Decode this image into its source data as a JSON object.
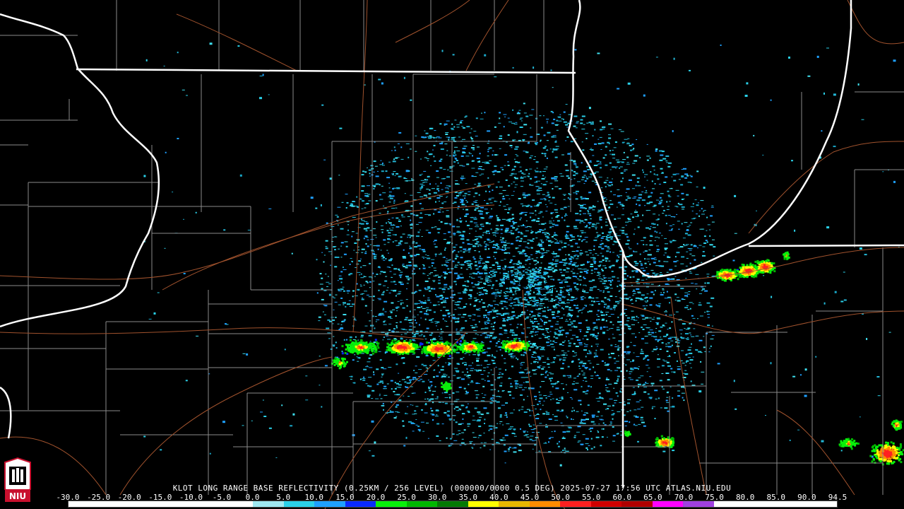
{
  "caption": "KLOT LONG RANGE BASE REFLECTIVITY (0.25KM / 256 LEVEL) (000000/0000 0.5 DEG) 2025-07-27 17:56 UTC  ATLAS.NIU.EDU",
  "logo_text": "NIU",
  "scale": {
    "labels": [
      "-30.0",
      "-25.0",
      "-20.0",
      "-15.0",
      "-10.0",
      "-5.0",
      "0.0",
      "5.0",
      "10.0",
      "15.0",
      "20.0",
      "25.0",
      "30.0",
      "35.0",
      "40.0",
      "45.0",
      "50.0",
      "55.0",
      "60.0",
      "65.0",
      "70.0",
      "75.0",
      "80.0",
      "85.0",
      "90.0",
      "94.5"
    ],
    "colors": [
      "#ffffff",
      "#ffffff",
      "#ffffff",
      "#ffffff",
      "#ffffff",
      "#ffffff",
      "#9ee7f0",
      "#2ad0e8",
      "#1ea0ff",
      "#0a2aff",
      "#08f00a",
      "#00b800",
      "#047a04",
      "#ffff00",
      "#e8b800",
      "#ff8c00",
      "#ff2020",
      "#d00000",
      "#b00000",
      "#ff00ff",
      "#a040e0",
      "#ffffff",
      "#ffffff",
      "#ffffff",
      "#ffffff"
    ]
  },
  "colors": {
    "background": "#000000",
    "state_border": "#ffffff",
    "county_line": "#8a8a8a",
    "highway": "#a0522d",
    "radar_site": "#000000"
  }
}
